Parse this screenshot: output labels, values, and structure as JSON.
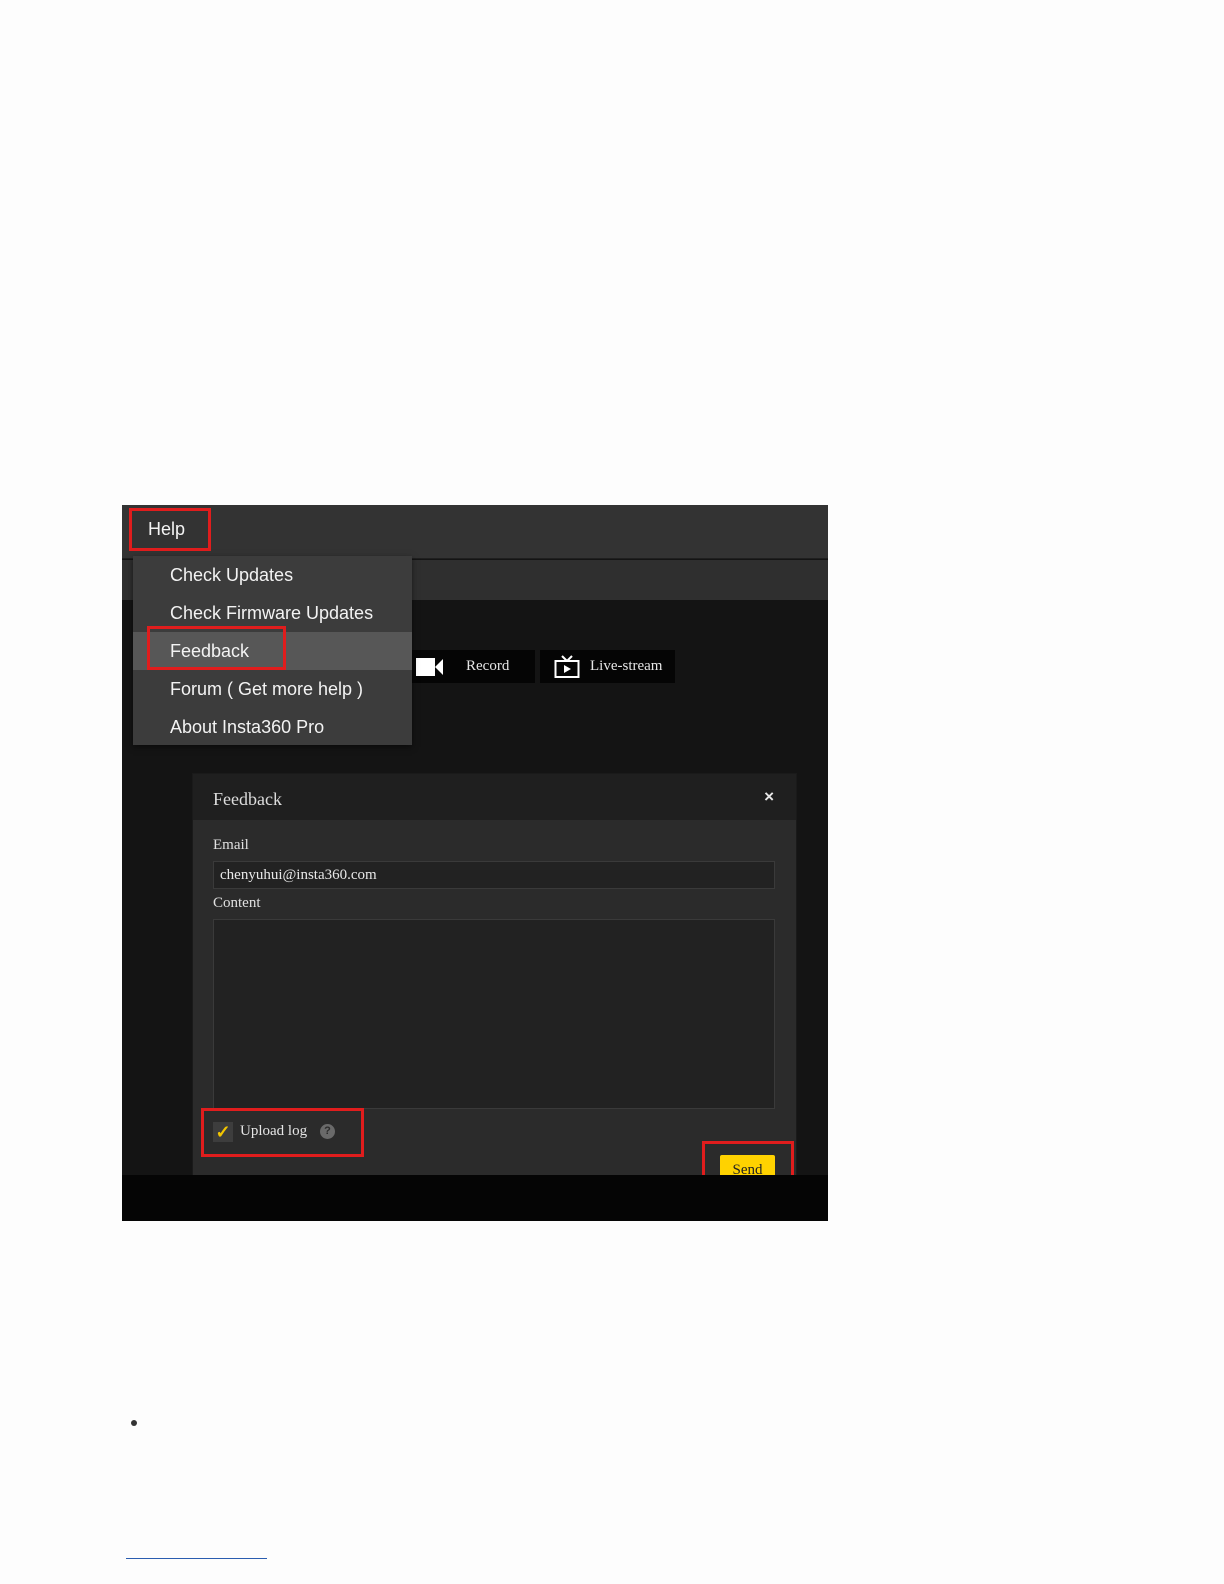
{
  "menubar": {
    "help_label": "Help"
  },
  "toolbar": {
    "record_label": "Record",
    "record_icon": "video-camera-icon",
    "live_label": "Live-stream",
    "live_icon": "tv-play-icon"
  },
  "help_menu": {
    "items": [
      {
        "label": "Check Updates"
      },
      {
        "label": "Check Firmware Updates"
      },
      {
        "label": "Feedback",
        "active": true
      },
      {
        "label": "Forum ( Get more help )"
      },
      {
        "label": "About Insta360 Pro"
      }
    ]
  },
  "feedback_dialog": {
    "title": "Feedback",
    "close_glyph": "×",
    "email_label": "Email",
    "email_value": "chenyuhui@insta360.com",
    "content_label": "Content",
    "content_value": "",
    "upload_log_label": "Upload log",
    "upload_log_checked": true,
    "check_glyph": "✓",
    "help_glyph": "?",
    "send_label": "Send"
  },
  "colors": {
    "highlight_box": "#e01d1d",
    "send_button": "#ffd200",
    "checkmark": "#f2c500"
  }
}
